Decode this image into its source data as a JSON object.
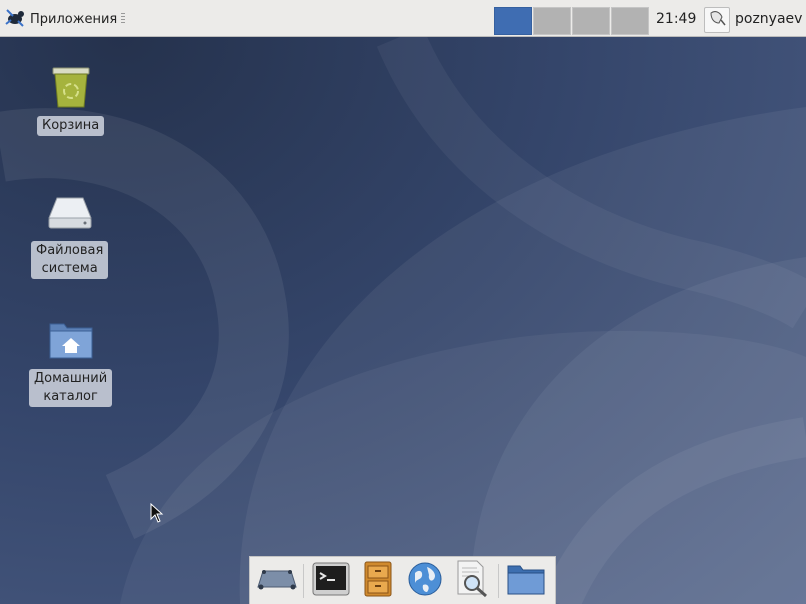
{
  "top_panel": {
    "app_menu_label": "Приложения",
    "app_menu_icon": "xfce-mouse-icon",
    "workspaces": [
      {
        "id": 1,
        "active": true
      },
      {
        "id": 2,
        "active": false
      },
      {
        "id": 3,
        "active": false
      },
      {
        "id": 4,
        "active": false
      }
    ],
    "clock": "21:49",
    "username": "poznyaev"
  },
  "desktop": {
    "icons": [
      {
        "label": "Корзина",
        "icon": "trash-icon"
      },
      {
        "label_line1": "Файловая",
        "label_line2": "система",
        "icon": "drive-icon"
      },
      {
        "label_line1": "Домашний",
        "label_line2": "каталог",
        "icon": "home-folder-icon"
      }
    ]
  },
  "dock": {
    "items": [
      {
        "icon": "show-desktop-icon"
      },
      {
        "icon": "terminal-icon"
      },
      {
        "icon": "file-manager-icon"
      },
      {
        "icon": "web-browser-icon"
      },
      {
        "icon": "app-finder-icon"
      },
      {
        "icon": "folder-icon"
      }
    ]
  },
  "colors": {
    "panel_bg": "#ecebe9",
    "workspace_active": "#3f6db2",
    "workspace_inactive": "#b2b2b2",
    "desktop_bg": "#34456a"
  }
}
